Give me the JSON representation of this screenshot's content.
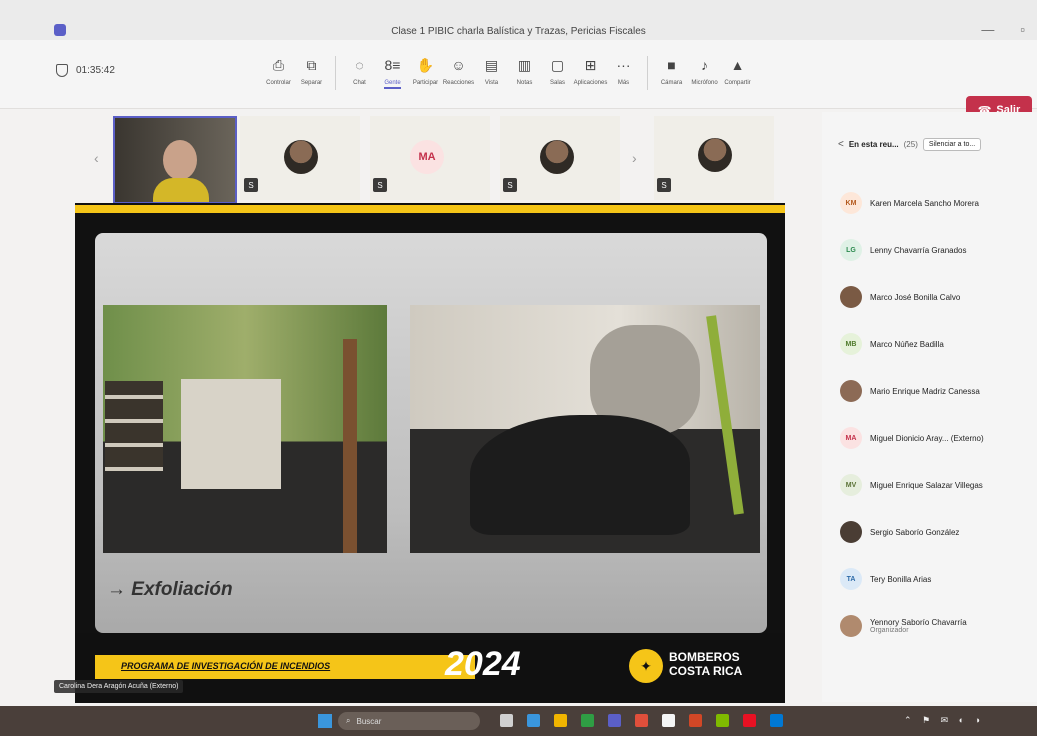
{
  "window": {
    "title": "Clase 1 PIBIC charla Balística y Trazas, Pericias Fiscales",
    "minimize": "—",
    "maximize": "▫"
  },
  "toolbar": {
    "timer": "01:35:42",
    "tools": [
      {
        "name": "control",
        "icon": "⎙",
        "label": "Controlar"
      },
      {
        "name": "separar",
        "icon": "⧉",
        "label": "Separar"
      },
      {
        "name": "chat",
        "icon": "◌",
        "label": "Chat"
      },
      {
        "name": "users",
        "icon": "8≡",
        "label": "Gente"
      },
      {
        "name": "raise-hand",
        "icon": "✋",
        "label": "Participar"
      },
      {
        "name": "reactions",
        "icon": "☺",
        "label": "Reacciones"
      },
      {
        "name": "view",
        "icon": "▤",
        "label": "Vista"
      },
      {
        "name": "notes",
        "icon": "▥",
        "label": "Notas"
      },
      {
        "name": "rooms",
        "icon": "▢",
        "label": "Salas"
      },
      {
        "name": "apps",
        "icon": "⊞",
        "label": "Aplicaciones"
      },
      {
        "name": "more",
        "icon": "···",
        "label": "Más"
      },
      {
        "name": "camera",
        "icon": "■",
        "label": "Cámara"
      },
      {
        "name": "mic",
        "icon": "♪",
        "label": "Micrófono"
      },
      {
        "name": "share",
        "icon": "▲",
        "label": "Compartir"
      }
    ],
    "leave_label": "Salir"
  },
  "strip": {
    "initials_tile": "MA",
    "badge": "S"
  },
  "slide": {
    "label": "→ Exfoliación",
    "program": "PROGRAMA DE INVESTIGACIÓN DE INCENDIOS",
    "year": "2024",
    "org_line1": "BOMBEROS",
    "org_line2": "COSTA RICA"
  },
  "presenter_name": "Carolina Dera Aragón Acuña (Externo)",
  "panel": {
    "back": "<",
    "title": "En esta reu...",
    "count": "(25)",
    "mute_all": "Silenciar a to..."
  },
  "participants": [
    {
      "initials": "KM",
      "name": "Karen Marcela Sancho Morera",
      "bg": "#fde7d9",
      "fg": "#b45a1e",
      "role": ""
    },
    {
      "initials": "LG",
      "name": "Lenny Chavarría Granados",
      "bg": "#dff1e6",
      "fg": "#2b8a4e",
      "role": ""
    },
    {
      "initials": "",
      "name": "Marco José Bonilla Calvo",
      "bg": "#7a5a44",
      "fg": "#fff",
      "role": ""
    },
    {
      "initials": "MB",
      "name": "Marco Núñez Badilla",
      "bg": "#e6f2da",
      "fg": "#4e7a2a",
      "role": ""
    },
    {
      "initials": "",
      "name": "Mario Enrique Madriz Canessa",
      "bg": "#8c6a55",
      "fg": "#fff",
      "role": ""
    },
    {
      "initials": "MA",
      "name": "Miguel Dionicio Aray... (Externo)",
      "bg": "#fbe2e2",
      "fg": "#c4314b",
      "role": ""
    },
    {
      "initials": "MV",
      "name": "Miguel Enrique Salazar Villegas",
      "bg": "#e6eedd",
      "fg": "#5a7236",
      "role": ""
    },
    {
      "initials": "",
      "name": "Sergio Saborío González",
      "bg": "#4a3d34",
      "fg": "#fff",
      "role": ""
    },
    {
      "initials": "TA",
      "name": "Tery Bonilla Arias",
      "bg": "#dbe9f7",
      "fg": "#2c6aa8",
      "role": ""
    },
    {
      "initials": "",
      "name": "Yennory Saborío Chavarría",
      "bg": "#b08a6e",
      "fg": "#fff",
      "role": "Organizador"
    }
  ],
  "taskbar": {
    "search_placeholder": "Buscar",
    "tray": "⌃ ⚑ ✉ ◐ ◑"
  }
}
